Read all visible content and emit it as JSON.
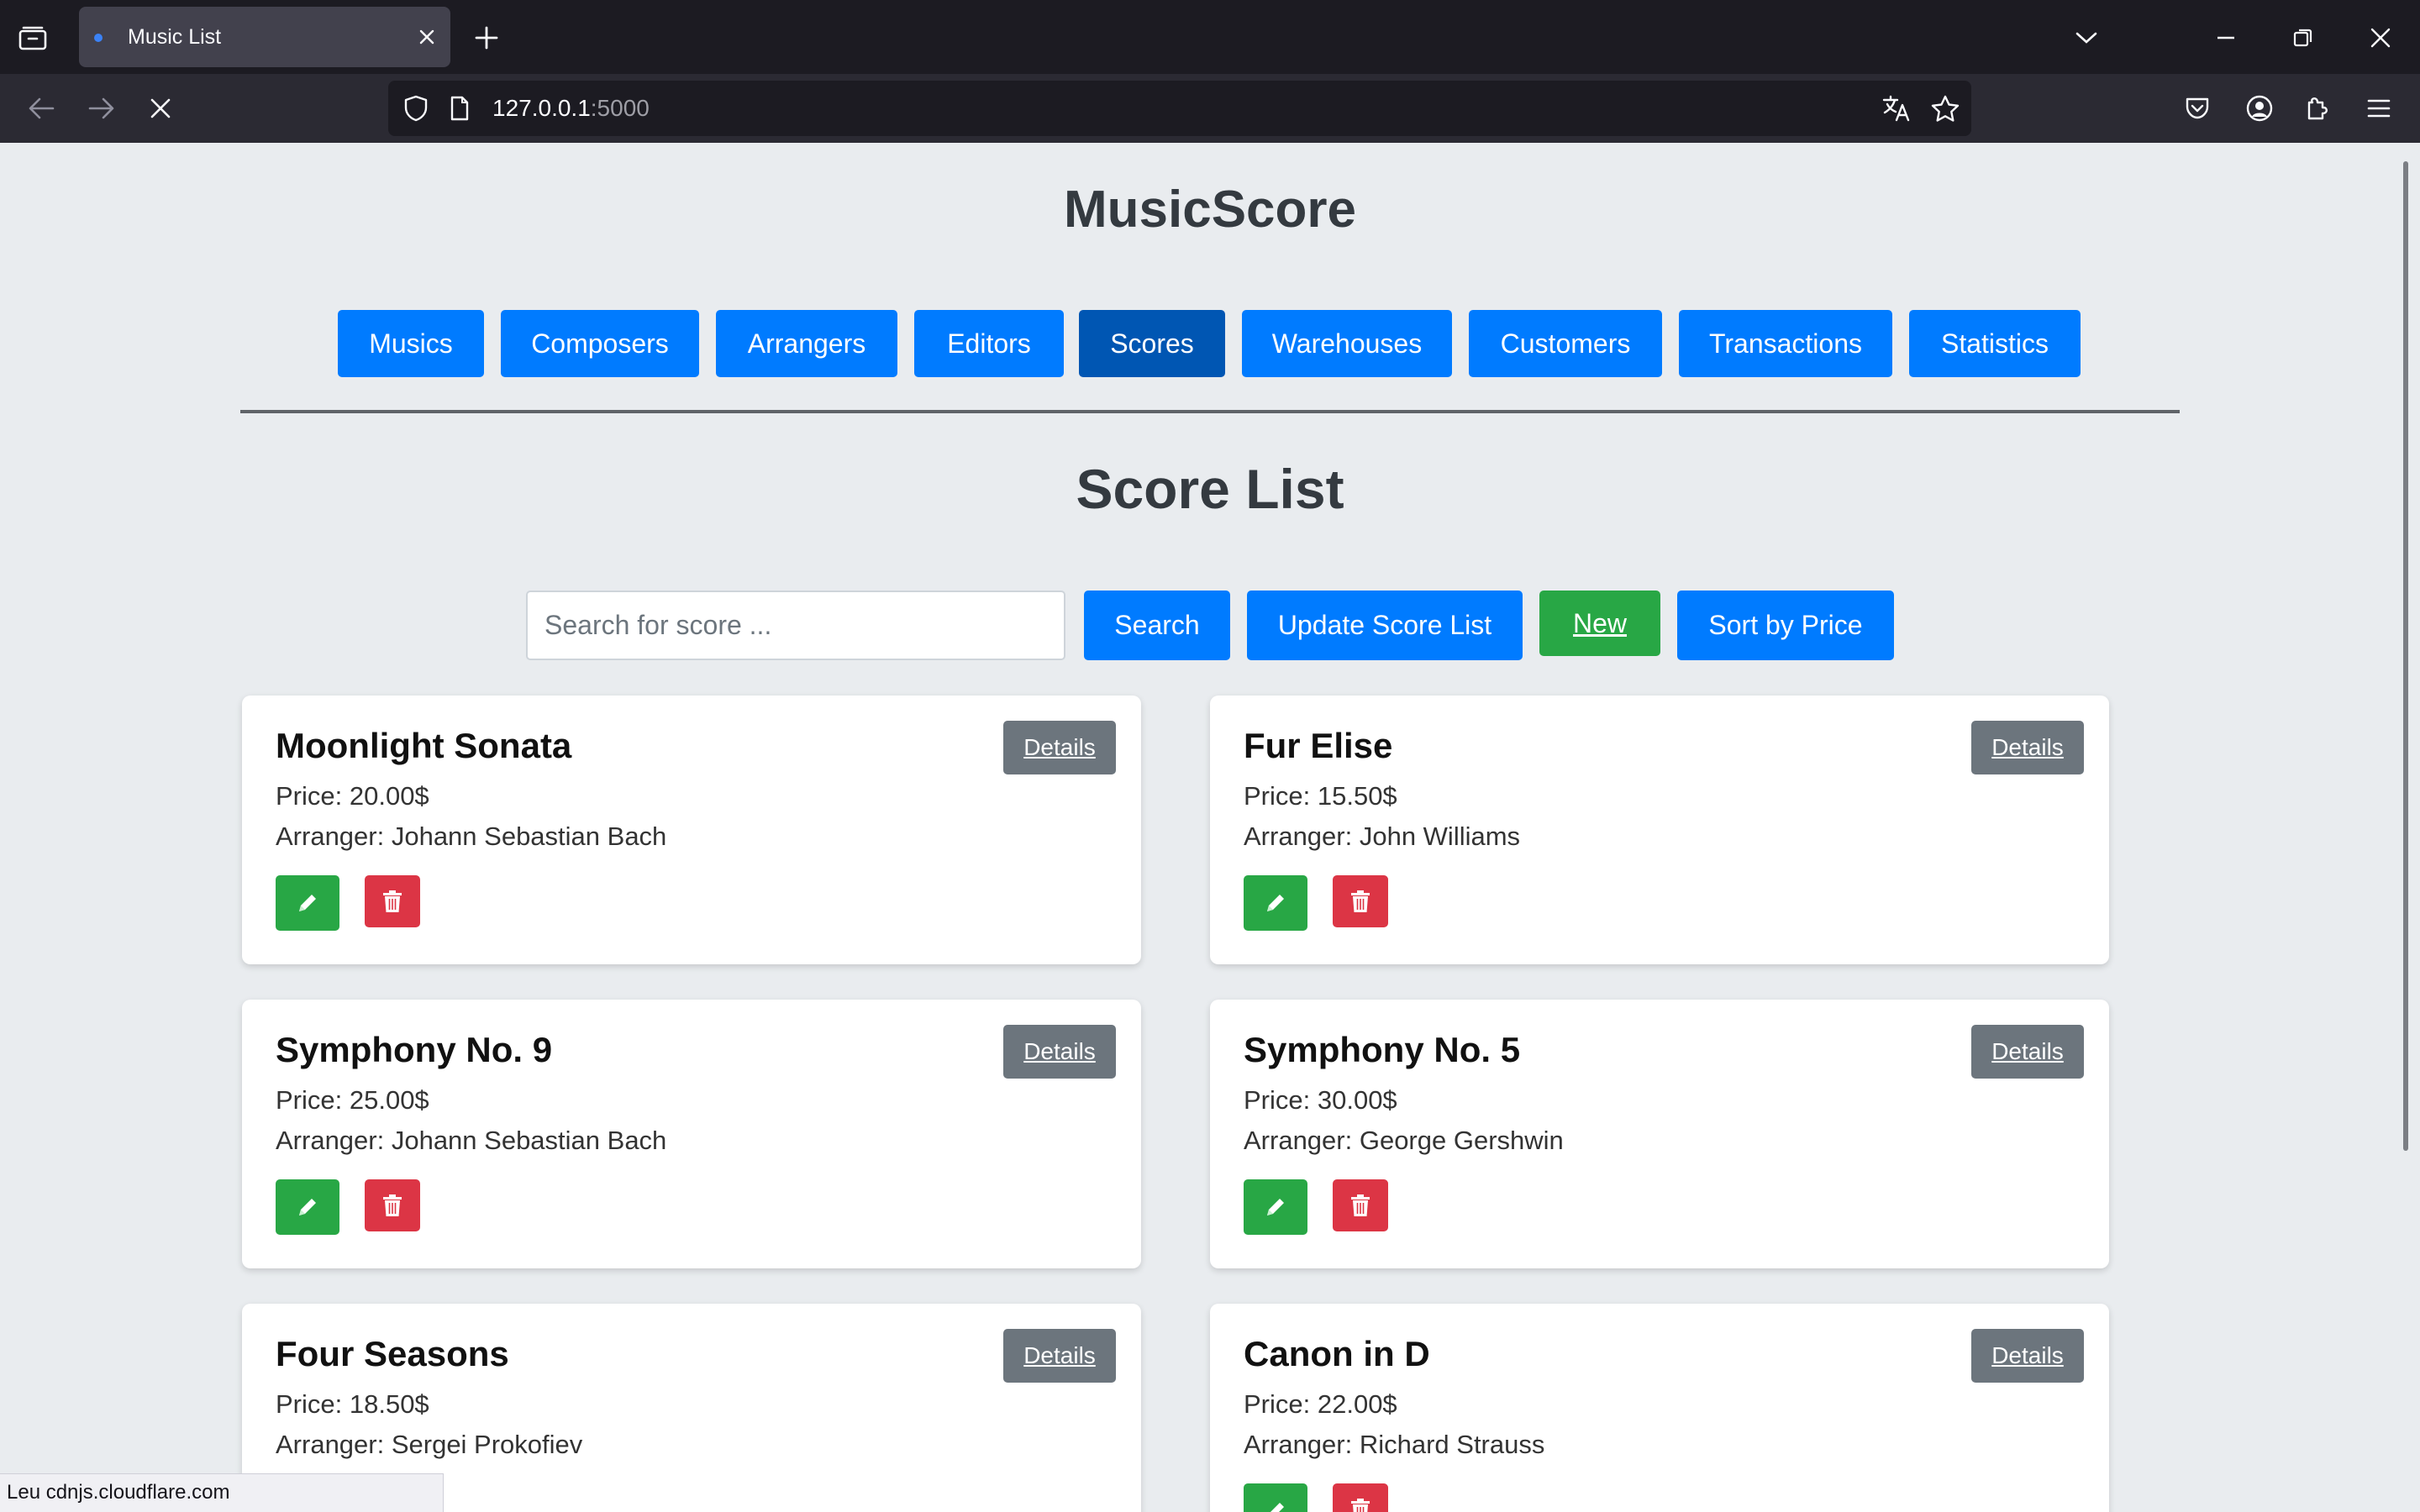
{
  "browser": {
    "tab_title": "Music List",
    "url_host": "127.0.0.1",
    "url_port": ":5000",
    "icons": [
      "tab-manager-icon",
      "close-icon",
      "plus-icon",
      "chevron-down-icon",
      "minimize-icon",
      "restore-icon",
      "window-close-icon",
      "back-icon",
      "forward-icon",
      "stop-loading-icon",
      "shield-icon",
      "page-icon",
      "translate-icon",
      "star-icon",
      "pocket-icon",
      "account-icon",
      "extensions-icon",
      "menu-icon"
    ]
  },
  "site": {
    "title": "MusicScore",
    "nav": [
      "Musics",
      "Composers",
      "Arrangers",
      "Editors",
      "Scores",
      "Warehouses",
      "Customers",
      "Transactions",
      "Statistics"
    ],
    "active_nav": "Scores"
  },
  "list": {
    "title": "Score List",
    "search_placeholder": "Search for score ...",
    "search_label": "Search",
    "update_label": "Update Score List",
    "new_label": "New",
    "sort_label": "Sort by Price",
    "details_label": "Details",
    "scores": [
      {
        "title": "Moonlight Sonata",
        "price": "Price: 20.00$",
        "arranger": "Arranger: Johann Sebastian Bach"
      },
      {
        "title": "Fur Elise",
        "price": "Price: 15.50$",
        "arranger": "Arranger: John Williams"
      },
      {
        "title": "Symphony No. 9",
        "price": "Price: 25.00$",
        "arranger": "Arranger: Johann Sebastian Bach"
      },
      {
        "title": "Symphony No. 5",
        "price": "Price: 30.00$",
        "arranger": "Arranger: George Gershwin"
      },
      {
        "title": "Four Seasons",
        "price": "Price: 18.50$",
        "arranger": "Arranger: Sergei Prokofiev"
      },
      {
        "title": "Canon in D",
        "price": "Price: 22.00$",
        "arranger": "Arranger: Richard Strauss"
      }
    ]
  },
  "status": "Leu cdnjs.cloudflare.com",
  "colors": {
    "primary": "#007bff",
    "primary_active": "#0056b3",
    "success": "#28a745",
    "danger": "#dc3545",
    "secondary": "#6c757d"
  }
}
